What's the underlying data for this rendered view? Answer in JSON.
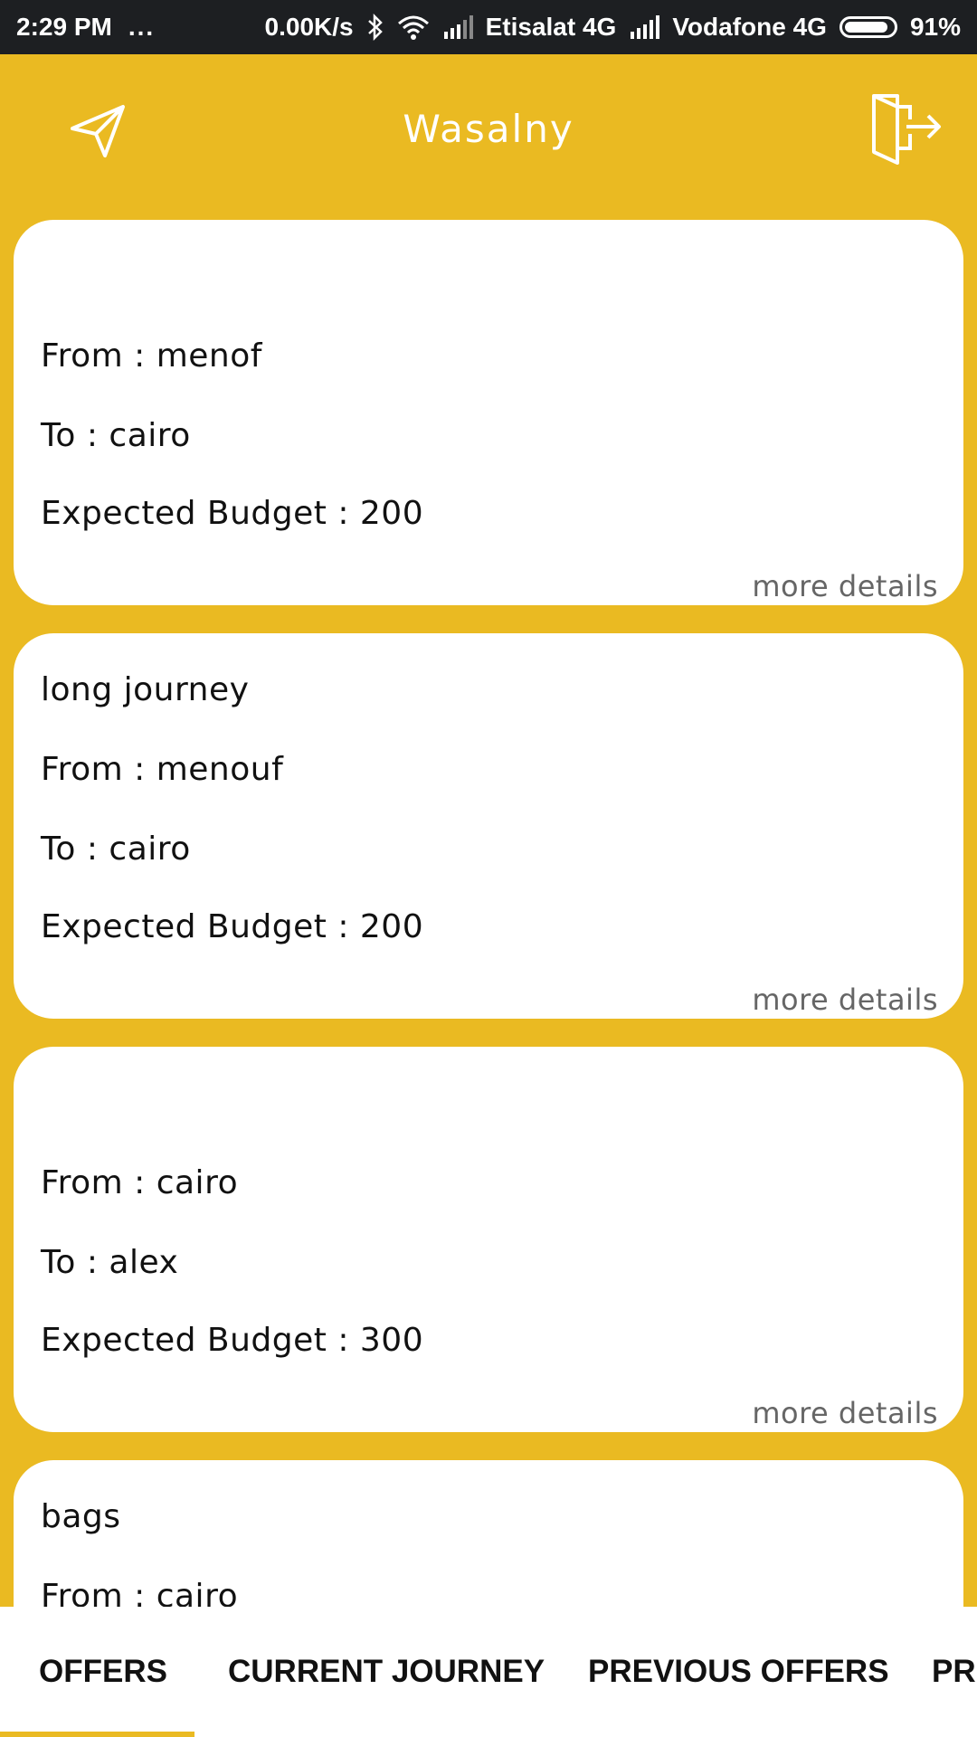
{
  "status_bar": {
    "time": "2:29 PM",
    "dots": "...",
    "speed": "0.00K/s",
    "carrier1": "Etisalat 4G",
    "carrier2": "Vodafone 4G",
    "battery": "91%",
    "battery_level": 0.91
  },
  "app_bar": {
    "title": "Wasalny",
    "left_icon": "send-icon",
    "right_icon": "logout-icon"
  },
  "cards": [
    {
      "title": "",
      "from": "From : menof",
      "to": "To : cairo",
      "budget": "Expected Budget : 200",
      "more": "more details"
    },
    {
      "title": "long journey",
      "from": "From : menouf",
      "to": "To : cairo",
      "budget": "Expected Budget : 200",
      "more": "more details"
    },
    {
      "title": "",
      "from": "From : cairo",
      "to": "To : alex",
      "budget": "Expected Budget : 300",
      "more": "more details"
    },
    {
      "title": "bags",
      "from": "From : cairo"
    }
  ],
  "tabs": {
    "items": [
      "OFFERS",
      "CURRENT JOURNEY",
      "PREVIOUS OFFERS",
      "PRO"
    ],
    "selected": "OFFERS"
  },
  "colors": {
    "background": "#EABA22",
    "card": "#FFFFFF",
    "status_bar": "#1D1F22",
    "indicator": "#EABA22"
  }
}
